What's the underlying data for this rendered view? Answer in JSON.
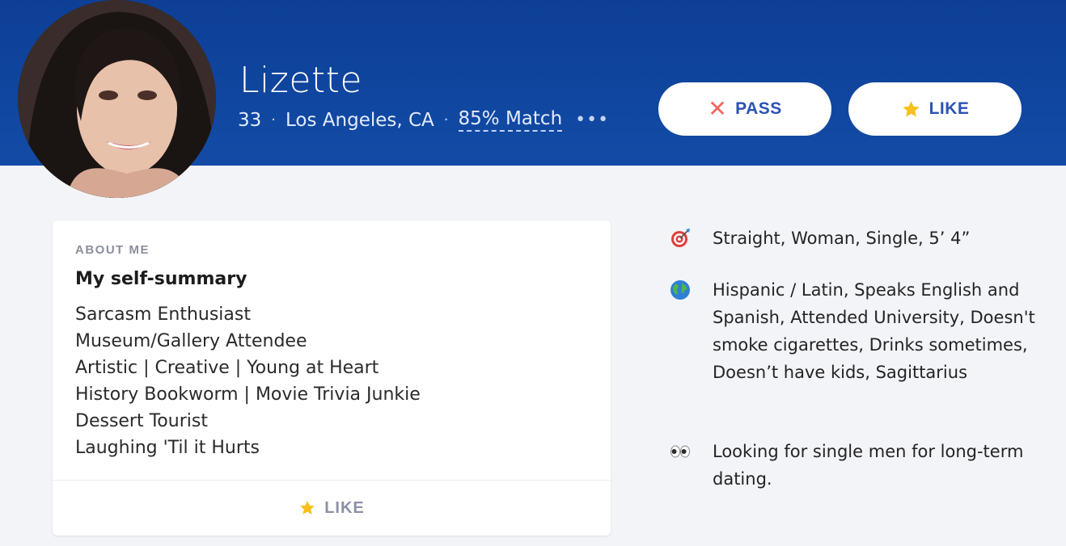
{
  "profile": {
    "name": "Lizette",
    "age": "33",
    "location": "Los Angeles, CA",
    "match": "85% Match",
    "more_icon": "•••"
  },
  "actions": {
    "pass_label": "PASS",
    "like_label": "LIKE"
  },
  "about": {
    "section_label": "ABOUT ME",
    "title": "My self-summary",
    "lines": [
      "Sarcasm Enthusiast",
      "Museum/Gallery Attendee",
      "Artistic | Creative | Young at Heart",
      "History Bookworm | Movie Trivia Junkie",
      "Dessert Tourist",
      "Laughing 'Til it Hurts"
    ],
    "like_label": "LIKE"
  },
  "details": [
    {
      "icon": "target-icon",
      "text": "Straight, Woman, Single, 5’ 4”"
    },
    {
      "icon": "globe-icon",
      "text": "Hispanic / Latin, Speaks English and Spanish, Attended University, Doesn't smoke cigarettes, Drinks sometimes, Doesn’t have kids, Sagittarius"
    },
    {
      "icon": "eyes-icon",
      "text": "Looking for single men for long-term dating."
    }
  ],
  "colors": {
    "header_bg": "#124ba6",
    "page_bg": "#f3f4f8",
    "button_text": "#2b52b5",
    "pass_x": "#f2665c",
    "star": "#f8c01a"
  }
}
